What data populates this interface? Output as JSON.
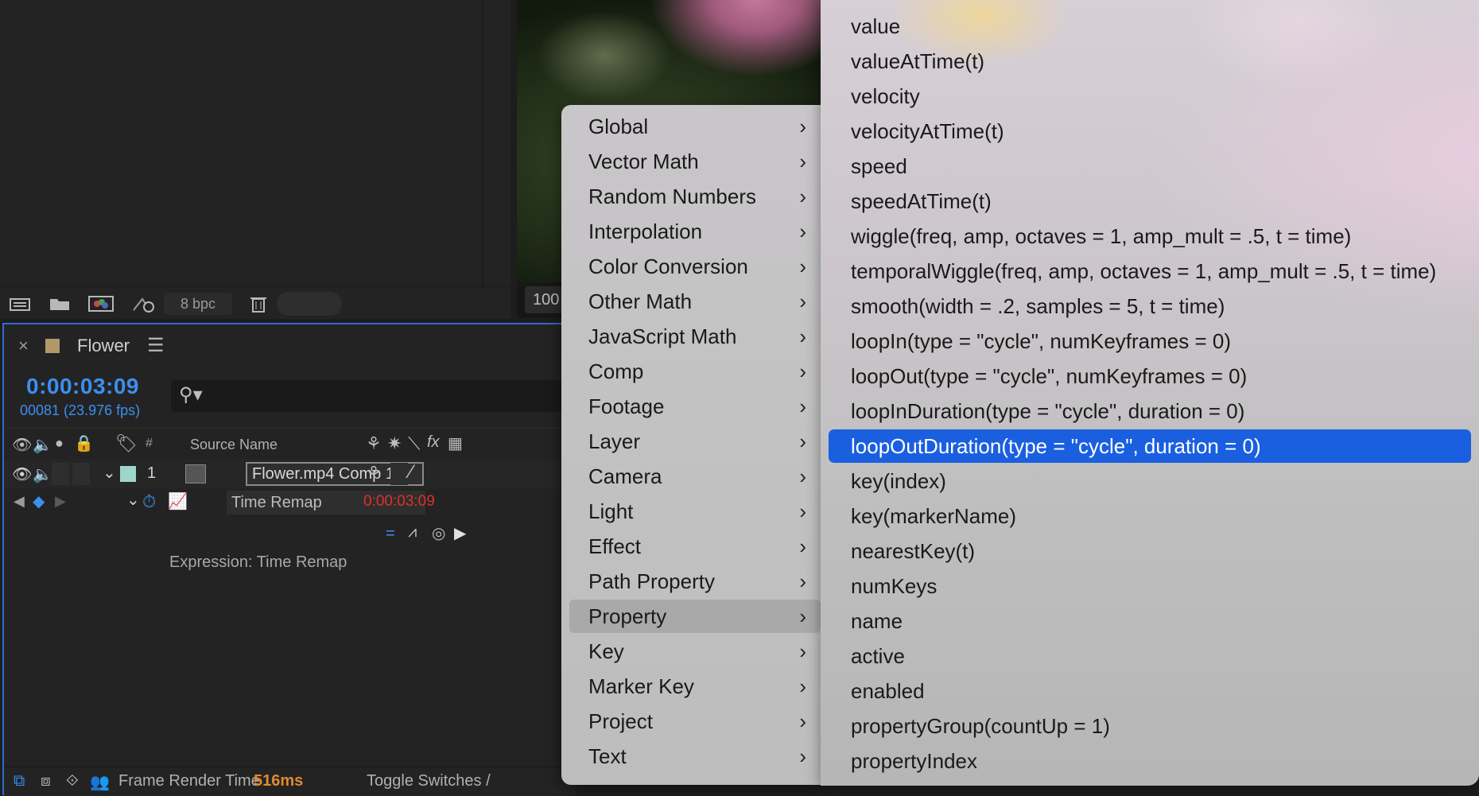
{
  "project_panel": {
    "bit_depth": "8 bpc"
  },
  "viewer": {
    "zoom": "100"
  },
  "timeline": {
    "comp_name": "Flower",
    "timecode": "0:00:03:09",
    "frames": "00081 (23.976 fps)",
    "columns": {
      "number": "#",
      "source_name": "Source Name"
    },
    "layer": {
      "index": "1",
      "name": "Flower.mp4 Comp 1"
    },
    "property": {
      "name": "Time Remap",
      "value": "0:00:03:09"
    },
    "expression_label": "Expression: Time Remap",
    "status": {
      "frame_render_label": "Frame Render Time",
      "frame_render_value": "516ms",
      "toggle_label": "Toggle Switches /"
    }
  },
  "menu": {
    "categories": [
      "Global",
      "Vector Math",
      "Random Numbers",
      "Interpolation",
      "Color Conversion",
      "Other Math",
      "JavaScript Math",
      "Comp",
      "Footage",
      "Layer",
      "Camera",
      "Light",
      "Effect",
      "Path Property",
      "Property",
      "Key",
      "Marker Key",
      "Project",
      "Text"
    ],
    "active_category": "Property",
    "submenu_items": [
      "value",
      "valueAtTime(t)",
      "velocity",
      "velocityAtTime(t)",
      "speed",
      "speedAtTime(t)",
      "wiggle(freq, amp, octaves = 1, amp_mult = .5, t = time)",
      "temporalWiggle(freq, amp, octaves = 1, amp_mult = .5, t = time)",
      "smooth(width = .2, samples = 5, t = time)",
      "loopIn(type = \"cycle\", numKeyframes = 0)",
      "loopOut(type = \"cycle\", numKeyframes = 0)",
      "loopInDuration(type = \"cycle\", duration = 0)",
      "loopOutDuration(type = \"cycle\", duration = 0)",
      "key(index)",
      "key(markerName)",
      "nearestKey(t)",
      "numKeys",
      "name",
      "active",
      "enabled",
      "propertyGroup(countUp = 1)",
      "propertyIndex"
    ],
    "selected_item": "loopOutDuration(type = \"cycle\", duration = 0)"
  },
  "colors": {
    "accent_blue": "#1a5fe0",
    "timecode_blue": "#3b8ff0",
    "time_value_red": "#e0302a",
    "render_orange": "#e08a30"
  }
}
